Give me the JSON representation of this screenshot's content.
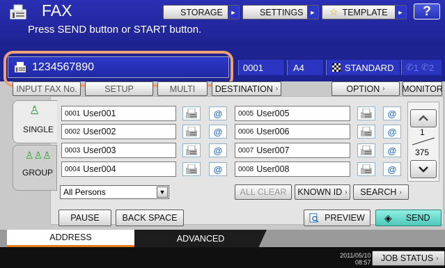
{
  "header": {
    "title": "FAX",
    "message": "Press SEND button or START button.",
    "buttons": {
      "storage": "STORAGE",
      "settings": "SETTINGS",
      "template": "TEMPLATE",
      "help": "?"
    }
  },
  "entry": {
    "number": "1234567890",
    "count": "0001",
    "paper": "A4",
    "resolution": "STANDARD",
    "line1": "1",
    "line2": "2"
  },
  "subrow": {
    "hidden_tab_labels": [
      "INPUT FAX No.",
      "SETUP",
      "MULTI",
      "DESTINATION"
    ],
    "option": "OPTION",
    "monitor": "MONITOR"
  },
  "sidetabs": {
    "single": "SINGLE",
    "group": "GROUP"
  },
  "address_book": {
    "left": [
      {
        "index": "0001",
        "name": "User001"
      },
      {
        "index": "0002",
        "name": "User002"
      },
      {
        "index": "0003",
        "name": "User003"
      },
      {
        "index": "0004",
        "name": "User004"
      }
    ],
    "right": [
      {
        "index": "0005",
        "name": "User005"
      },
      {
        "index": "0006",
        "name": "User006"
      },
      {
        "index": "0007",
        "name": "User007"
      },
      {
        "index": "0008",
        "name": "User008"
      }
    ]
  },
  "paging": {
    "current": "1",
    "total": "375"
  },
  "filter": {
    "selected": "All Persons"
  },
  "actions": {
    "all_clear": "ALL CLEAR",
    "known_id": "KNOWN ID",
    "search": "SEARCH"
  },
  "bottom": {
    "pause": "PAUSE",
    "backspace": "BACK SPACE",
    "preview": "PREVIEW",
    "send": "SEND"
  },
  "tabs": {
    "address": "ADDRESS",
    "advanced": "ADVANCED"
  },
  "status": {
    "date": "2011/05/10",
    "time": "08:57",
    "job_status": "JOB STATUS"
  },
  "colors": {
    "header_blue": "#1e2392",
    "accent_orange": "#e67c1c",
    "send_green": "#4dc7b9",
    "highlight_ring": "#f0a077"
  }
}
